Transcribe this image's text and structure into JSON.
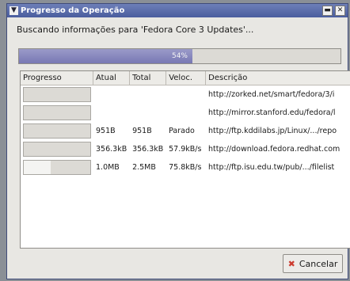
{
  "window": {
    "title": "Progresso da Operação",
    "status_message": "Buscando informações para 'Fedora Core 3 Updates'..."
  },
  "overall_progress": {
    "percent_label": "54%",
    "fraction": 0.54
  },
  "table": {
    "columns": [
      "Progresso",
      "Atual",
      "Total",
      "Veloc.",
      "Descrição"
    ],
    "rows": [
      {
        "progress": 0.0,
        "current": "",
        "total": "",
        "speed": "",
        "description": "http://zorked.net/smart/fedora/3/i"
      },
      {
        "progress": 0.0,
        "current": "",
        "total": "",
        "speed": "",
        "description": "http://mirror.stanford.edu/fedora/l"
      },
      {
        "progress": 0.0,
        "current": "951B",
        "total": "951B",
        "speed": "Parado",
        "description": "http://ftp.kddilabs.jp/Linux/.../repo"
      },
      {
        "progress": 0.0,
        "current": "356.3kB",
        "total": "356.3kB",
        "speed": "57.9kB/s",
        "description": "http://download.fedora.redhat.com"
      },
      {
        "progress": 0.4,
        "current": "1.0MB",
        "total": "2.5MB",
        "speed": "75.8kB/s",
        "description": "http://ftp.isu.edu.tw/pub/.../filelist"
      }
    ]
  },
  "buttons": {
    "cancel": "Cancelar"
  },
  "icons": {
    "menu": "chevron-down-icon",
    "minimize": "minimize-icon",
    "close": "close-icon",
    "cancel": "cancel-x-icon"
  },
  "colors": {
    "titlebar": "#4a5d9e",
    "progress_fill": "#7878b3",
    "cancel_icon": "#cc3b2f"
  }
}
